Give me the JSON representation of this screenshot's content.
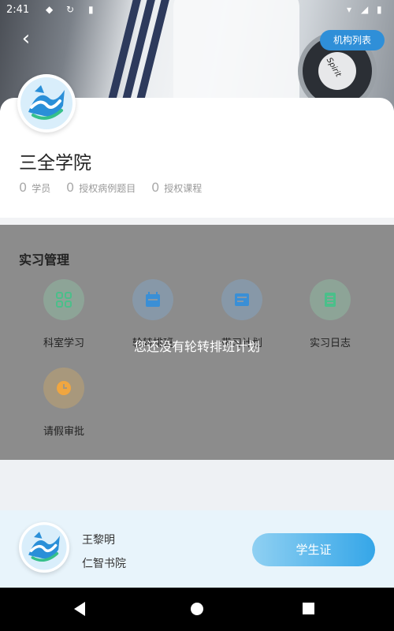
{
  "status_bar": {
    "time": "2:41",
    "icons": [
      "shield-icon",
      "sync-icon",
      "sd-card-icon",
      "wifi-icon",
      "signal-icon",
      "battery-icon"
    ]
  },
  "header": {
    "back_icon": "chevron-left-icon",
    "org_list_label": "机构列表"
  },
  "institution": {
    "name": "三全学院",
    "stats": [
      {
        "value": "0",
        "label": "学员"
      },
      {
        "value": "0",
        "label": "授权病例题目"
      },
      {
        "value": "0",
        "label": "授权课程"
      }
    ]
  },
  "practice": {
    "title": "实习管理",
    "items": [
      {
        "label": "科室学习",
        "icon": "grid-icon",
        "color": "#4bbf8a"
      },
      {
        "label": "轮转排班",
        "icon": "calendar-icon",
        "color": "#3a8fd6"
      },
      {
        "label": "带习计划",
        "icon": "plan-icon",
        "color": "#3a8fd6"
      },
      {
        "label": "实习日志",
        "icon": "notebook-icon",
        "color": "#4bbf8a"
      },
      {
        "label": "请假审批",
        "icon": "clock-icon",
        "color": "#f0a640"
      }
    ],
    "empty_message": "您还没有轮转排班计划"
  },
  "user": {
    "name": "王黎明",
    "school": "仁智书院",
    "student_card_label": "学生证"
  },
  "colors": {
    "accent": "#2f8fd8",
    "overlay": "#8c8c8c"
  }
}
